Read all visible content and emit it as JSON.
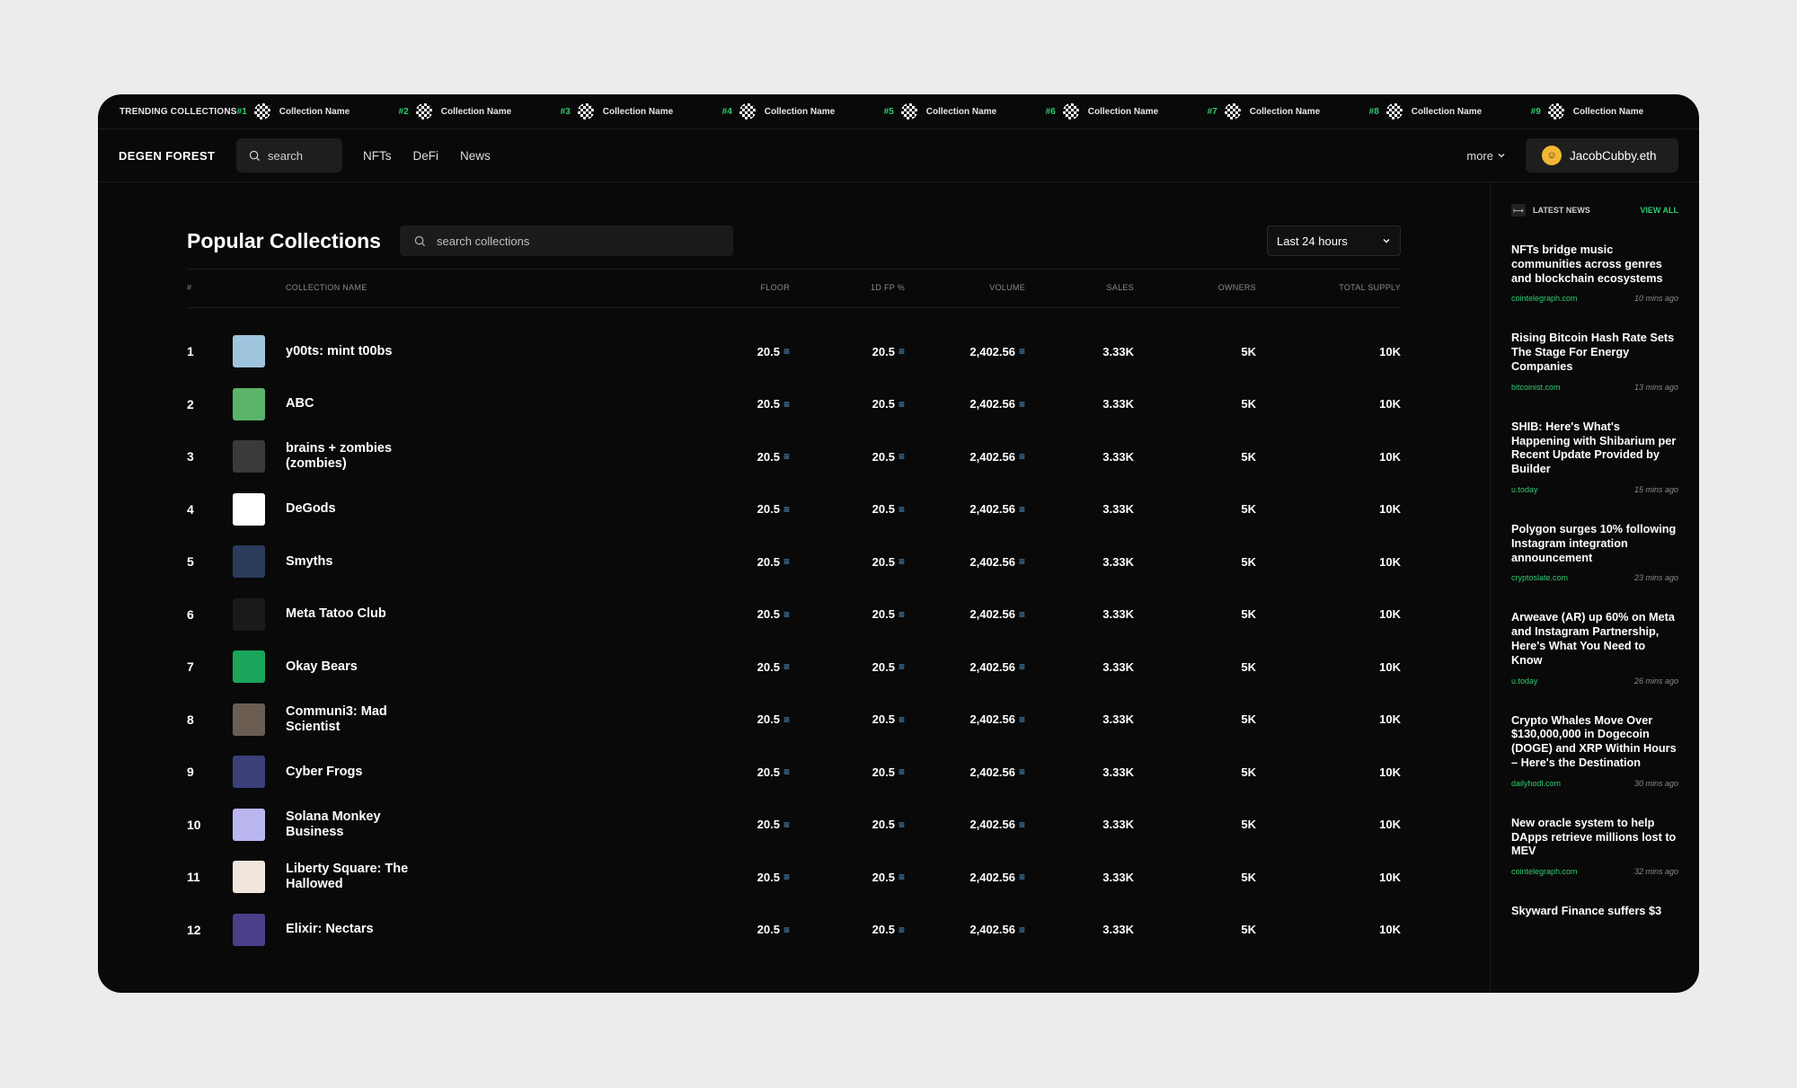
{
  "ticker": {
    "title": "TRENDING COLLECTIONS",
    "items": [
      {
        "rank": "#1",
        "name": "Collection Name"
      },
      {
        "rank": "#2",
        "name": "Collection Name"
      },
      {
        "rank": "#3",
        "name": "Collection Name"
      },
      {
        "rank": "#4",
        "name": "Collection Name"
      },
      {
        "rank": "#5",
        "name": "Collection Name"
      },
      {
        "rank": "#6",
        "name": "Collection Name"
      },
      {
        "rank": "#7",
        "name": "Collection Name"
      },
      {
        "rank": "#8",
        "name": "Collection Name"
      },
      {
        "rank": "#9",
        "name": "Collection Name"
      }
    ]
  },
  "nav": {
    "logo": "DEGEN FOREST",
    "search_placeholder": "search",
    "links": [
      "NFTs",
      "DeFi",
      "News"
    ],
    "more": "more",
    "user": "JacobCubby.eth"
  },
  "main": {
    "title": "Popular Collections",
    "search_placeholder": "search collections",
    "period": "Last 24 hours",
    "columns": {
      "rank": "#",
      "name": "COLLECTION NAME",
      "floor": "FLOOR",
      "fp": "1D FP %",
      "volume": "VOLUME",
      "sales": "SALES",
      "owners": "OWNERS",
      "supply": "TOTAL SUPPLY"
    },
    "currency_symbol": "≡",
    "rows": [
      {
        "rank": "1",
        "name": "y00ts: mint t00bs",
        "floor": "20.5",
        "fp": "20.5",
        "volume": "2,402.56",
        "sales": "3.33K",
        "owners": "5K",
        "supply": "10K",
        "thumb_color": "#9fc4de"
      },
      {
        "rank": "2",
        "name": "ABC",
        "floor": "20.5",
        "fp": "20.5",
        "volume": "2,402.56",
        "sales": "3.33K",
        "owners": "5K",
        "supply": "10K",
        "thumb_color": "#5bb36a"
      },
      {
        "rank": "3",
        "name": "brains + zombies (zombies)",
        "floor": "20.5",
        "fp": "20.5",
        "volume": "2,402.56",
        "sales": "3.33K",
        "owners": "5K",
        "supply": "10K",
        "thumb_color": "#3a3a3a"
      },
      {
        "rank": "4",
        "name": "DeGods",
        "floor": "20.5",
        "fp": "20.5",
        "volume": "2,402.56",
        "sales": "3.33K",
        "owners": "5K",
        "supply": "10K",
        "thumb_color": "#ffffff"
      },
      {
        "rank": "5",
        "name": "Smyths",
        "floor": "20.5",
        "fp": "20.5",
        "volume": "2,402.56",
        "sales": "3.33K",
        "owners": "5K",
        "supply": "10K",
        "thumb_color": "#2a3b5c"
      },
      {
        "rank": "6",
        "name": "Meta Tatoo Club",
        "floor": "20.5",
        "fp": "20.5",
        "volume": "2,402.56",
        "sales": "3.33K",
        "owners": "5K",
        "supply": "10K",
        "thumb_color": "#1a1a1a"
      },
      {
        "rank": "7",
        "name": "Okay Bears",
        "floor": "20.5",
        "fp": "20.5",
        "volume": "2,402.56",
        "sales": "3.33K",
        "owners": "5K",
        "supply": "10K",
        "thumb_color": "#1aa55a"
      },
      {
        "rank": "8",
        "name": "Communi3: Mad Scientist",
        "floor": "20.5",
        "fp": "20.5",
        "volume": "2,402.56",
        "sales": "3.33K",
        "owners": "5K",
        "supply": "10K",
        "thumb_color": "#6b5d52"
      },
      {
        "rank": "9",
        "name": "Cyber Frogs",
        "floor": "20.5",
        "fp": "20.5",
        "volume": "2,402.56",
        "sales": "3.33K",
        "owners": "5K",
        "supply": "10K",
        "thumb_color": "#3b3f7a"
      },
      {
        "rank": "10",
        "name": "Solana Monkey Business",
        "floor": "20.5",
        "fp": "20.5",
        "volume": "2,402.56",
        "sales": "3.33K",
        "owners": "5K",
        "supply": "10K",
        "thumb_color": "#b9b6f0"
      },
      {
        "rank": "11",
        "name": "Liberty Square: The Hallowed",
        "floor": "20.5",
        "fp": "20.5",
        "volume": "2,402.56",
        "sales": "3.33K",
        "owners": "5K",
        "supply": "10K",
        "thumb_color": "#f1e6dc"
      },
      {
        "rank": "12",
        "name": "Elixir: Nectars",
        "floor": "20.5",
        "fp": "20.5",
        "volume": "2,402.56",
        "sales": "3.33K",
        "owners": "5K",
        "supply": "10K",
        "thumb_color": "#4b3f8a"
      }
    ]
  },
  "sidebar": {
    "title": "LATEST NEWS",
    "view_all": "VIEW ALL",
    "news": [
      {
        "title": "NFTs bridge music communities across genres and blockchain ecosystems",
        "source": "cointelegraph.com",
        "time": "10 mins ago"
      },
      {
        "title": "Rising Bitcoin Hash Rate Sets The Stage For Energy Companies",
        "source": "bitcoinist.com",
        "time": "13 mins ago"
      },
      {
        "title": "SHIB: Here's What's Happening with Shibarium per Recent Update Provided by Builder",
        "source": "u.today",
        "time": "15 mins ago"
      },
      {
        "title": "Polygon surges 10% following Instagram integration announcement",
        "source": "cryptoslate.com",
        "time": "23 mins ago"
      },
      {
        "title": "Arweave (AR) up 60% on Meta and Instagram Partnership, Here's What You Need to Know",
        "source": "u.today",
        "time": "26 mins ago"
      },
      {
        "title": "Crypto Whales Move Over $130,000,000 in Dogecoin (DOGE) and XRP Within Hours – Here's the Destination",
        "source": "dailyhodl.com",
        "time": "30 mins ago"
      },
      {
        "title": "New oracle system to help DApps retrieve millions lost to MEV",
        "source": "cointelegraph.com",
        "time": "32 mins ago"
      },
      {
        "title": "Skyward Finance suffers $3",
        "source": "",
        "time": ""
      }
    ]
  }
}
